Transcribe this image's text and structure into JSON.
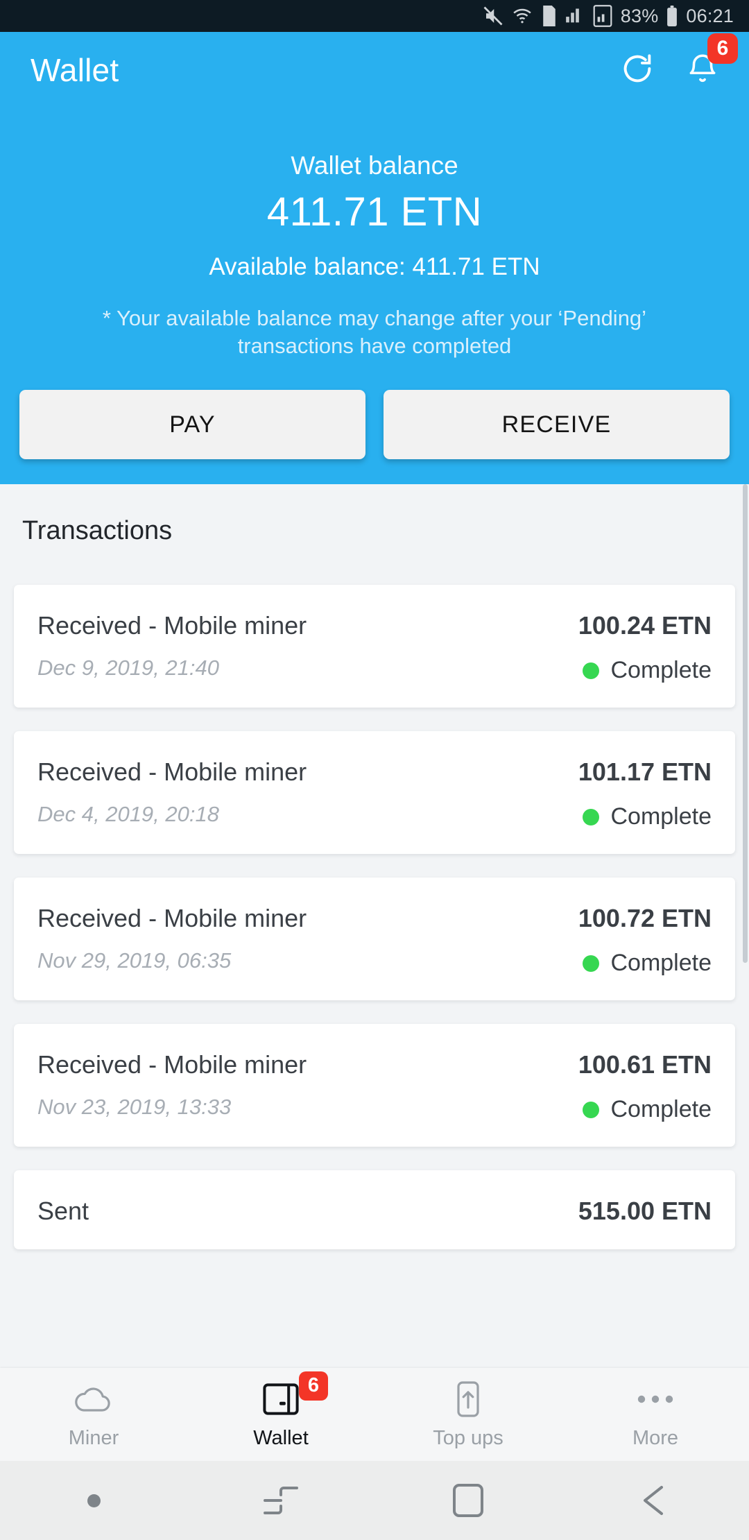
{
  "statusbar": {
    "battery_percent": "83%",
    "time": "06:21",
    "icons": [
      "mute-icon",
      "wifi-icon",
      "sim-card-icon",
      "signal-1-icon",
      "signal-2-icon",
      "battery-icon"
    ]
  },
  "appbar": {
    "title": "Wallet",
    "refresh_icon": "refresh-icon",
    "notifications_icon": "bell-icon",
    "notifications_badge": "6"
  },
  "balance": {
    "label": "Wallet balance",
    "amount": "411.71 ETN",
    "available": "Available balance: 411.71 ETN",
    "note": "* Your available balance may change after your ‘Pending’ transactions have completed"
  },
  "actions": {
    "pay_label": "PAY",
    "receive_label": "RECEIVE"
  },
  "transactions": {
    "heading": "Transactions",
    "items": [
      {
        "title": "Received - Mobile miner",
        "date": "Dec 9, 2019, 21:40",
        "amount": "100.24 ETN",
        "status": "Complete"
      },
      {
        "title": "Received - Mobile miner",
        "date": "Dec 4, 2019, 20:18",
        "amount": "101.17 ETN",
        "status": "Complete"
      },
      {
        "title": "Received - Mobile miner",
        "date": "Nov 29, 2019, 06:35",
        "amount": "100.72 ETN",
        "status": "Complete"
      },
      {
        "title": "Received - Mobile miner",
        "date": "Nov 23, 2019, 13:33",
        "amount": "100.61 ETN",
        "status": "Complete"
      },
      {
        "title": "Sent",
        "date": "",
        "amount": "515.00 ETN",
        "status": ""
      }
    ]
  },
  "bottom_nav": {
    "items": [
      {
        "label": "Miner",
        "icon": "cloud-icon",
        "badge": "",
        "active": false
      },
      {
        "label": "Wallet",
        "icon": "wallet-icon",
        "badge": "6",
        "active": true
      },
      {
        "label": "Top ups",
        "icon": "phone-upload-icon",
        "badge": "",
        "active": false
      },
      {
        "label": "More",
        "icon": "ellipsis-icon",
        "badge": "",
        "active": false
      }
    ]
  },
  "android_nav": {
    "items": [
      "dot-indicator-icon",
      "recents-icon",
      "home-icon",
      "back-icon"
    ]
  },
  "colors": {
    "accent": "#29b0ef",
    "badge": "#f33527",
    "status_complete": "#36d751",
    "page_bg": "#f2f4f6"
  }
}
